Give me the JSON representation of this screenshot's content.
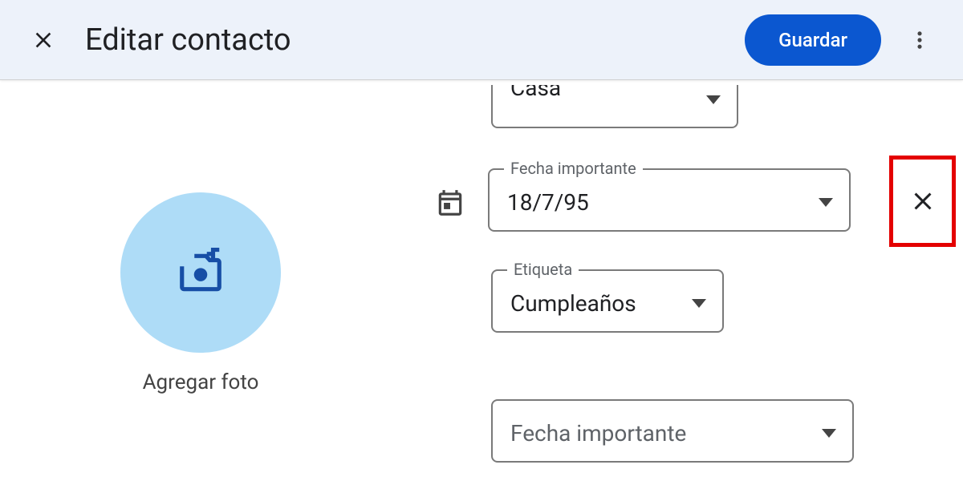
{
  "header": {
    "title": "Editar contacto",
    "save_label": "Guardar"
  },
  "photo": {
    "add_label": "Agregar foto"
  },
  "fields": {
    "top_partial_value": "Casa",
    "date_label": "Fecha importante",
    "date_value": "18/7/95",
    "tag_label": "Etiqueta",
    "tag_value": "Cumpleaños",
    "add_date_placeholder": "Fecha importante"
  }
}
